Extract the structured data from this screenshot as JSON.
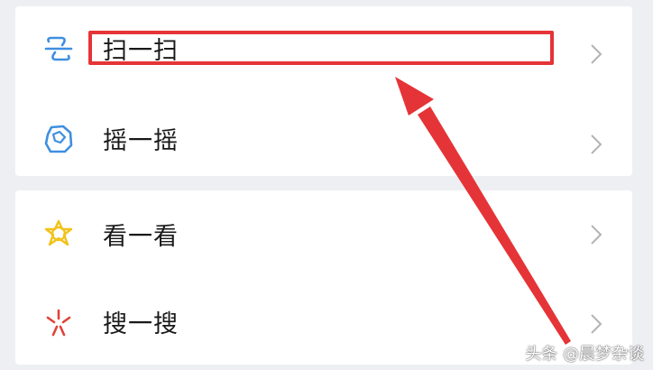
{
  "colors": {
    "background": "#eeeff2",
    "card": "#ffffff",
    "text": "#191919",
    "chevron": "#b3b3b3",
    "annotation_red": "#e53437",
    "scan_icon": "#3f8fe0",
    "shake_icon": "#3f8fe0",
    "look_icon": "#f2c21a",
    "search_icon": "#e0433a"
  },
  "menu": {
    "group1": [
      {
        "label": "扫一扫",
        "icon": "scan-icon"
      },
      {
        "label": "摇一摇",
        "icon": "shake-icon"
      }
    ],
    "group2": [
      {
        "label": "看一看",
        "icon": "look-icon"
      },
      {
        "label": "搜一搜",
        "icon": "search-icon"
      }
    ]
  },
  "watermark": "头条 @晨梦杂谈"
}
